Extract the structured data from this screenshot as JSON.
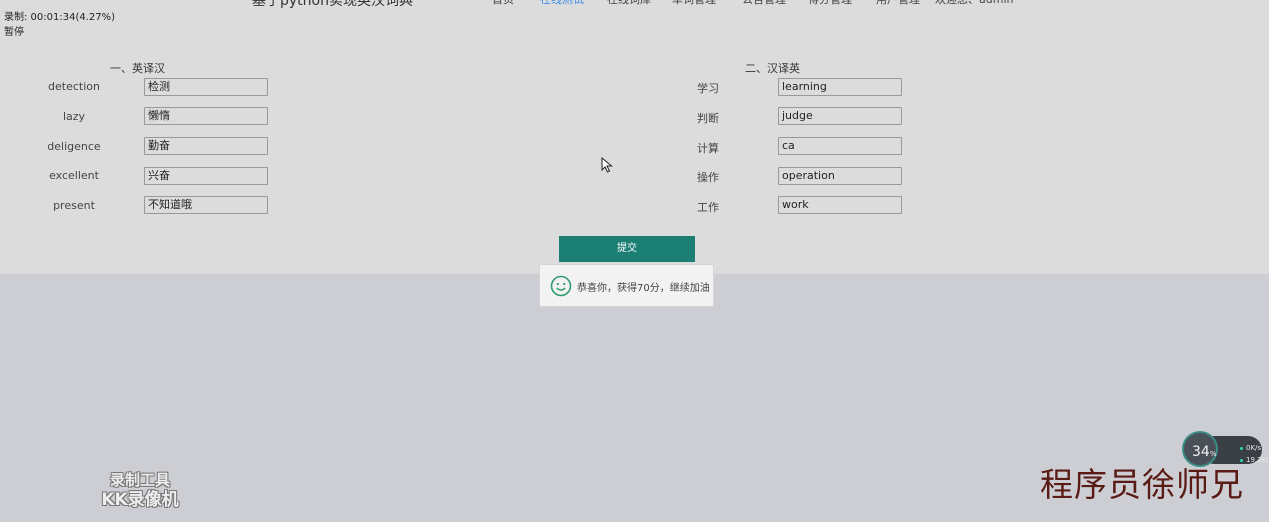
{
  "overlay": {
    "recording_line": "录制: 00:01:34(4.27%)",
    "speed_line": "暂停"
  },
  "header": {
    "site_title": "基于python实现英汉词典",
    "nav": [
      {
        "label": "首页",
        "active": false
      },
      {
        "label": "在线测试",
        "active": true
      },
      {
        "label": "在线词库",
        "active": false
      },
      {
        "label": "单词管理",
        "active": false
      },
      {
        "label": "公告管理",
        "active": false
      },
      {
        "label": "得分管理",
        "active": false
      },
      {
        "label": "用户管理",
        "active": false
      },
      {
        "label": "欢迎您、admin",
        "active": false
      }
    ]
  },
  "quiz": {
    "en_to_cn": {
      "title": "一、英译汉",
      "items": [
        {
          "word": "detection",
          "answer": "检测"
        },
        {
          "word": "lazy",
          "answer": "懒惰"
        },
        {
          "word": "deligence",
          "answer": "勤奋"
        },
        {
          "word": "excellent",
          "answer": "兴奋"
        },
        {
          "word": "present",
          "answer": "不知道哦"
        }
      ]
    },
    "cn_to_en": {
      "title": "二、汉译英",
      "items": [
        {
          "word": "学习",
          "answer": "learning"
        },
        {
          "word": "判断",
          "answer": "judge"
        },
        {
          "word": "计算",
          "answer": "ca"
        },
        {
          "word": "操作",
          "answer": "operation"
        },
        {
          "word": "工作",
          "answer": "work"
        }
      ]
    },
    "submit_label": "提交",
    "result_message": "恭喜你，获得70分，继续加油"
  },
  "colors": {
    "submit_bg": "#1c7f74",
    "nav_active": "#3a8ee6",
    "toast_icon": "#2e9a6e"
  },
  "widgets": {
    "recorder_brand_line1": "录制工具",
    "recorder_brand_line2": "KK录像机",
    "cpu_percent": "34",
    "cpu_unit": "%",
    "upload_speed": "0K/s",
    "download_speed": "19.2K/s",
    "author_watermark": "程序员徐师兄"
  }
}
